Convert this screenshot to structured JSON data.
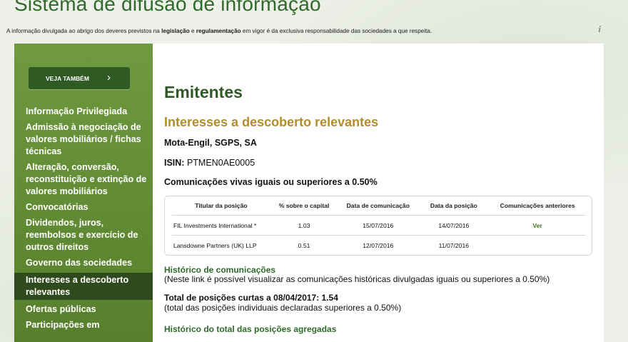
{
  "site": {
    "title": "Sistema de difusão de informação",
    "disclaimer": {
      "part1": "A informação divulgada ao abrigo dos deveres previstos na ",
      "bold1": "legislação",
      "part2": " e ",
      "bold2": "regulamentação",
      "part3": " em vigor é da exclusiva responsabilidade das sociedades a que respeita."
    },
    "info_icon": "i"
  },
  "sidebar": {
    "veja_label": "VEJA TAMBÉM",
    "veja_chevron": "›",
    "items": [
      {
        "label": "Informação Privilegiada"
      },
      {
        "label": "Admissão à negociação de valores mobiliários / fichas técnicas"
      },
      {
        "label": "Alteração, conversão, reconstituição e extinção de valores mobiliários"
      },
      {
        "label": "Convocatórias"
      },
      {
        "label": "Dividendos, juros, reembolsos e exercício de outros direitos"
      },
      {
        "label": "Governo das sociedades"
      },
      {
        "label": "Interesses a descoberto relevantes",
        "active": true
      },
      {
        "label": "Ofertas públicas"
      },
      {
        "label": "Participações em"
      }
    ]
  },
  "main": {
    "heading": "Emitentes",
    "subheading": "Interesses a descoberto relevantes",
    "company": "Mota-Engil, SGPS, SA",
    "isin_label": "ISIN:",
    "isin_value": " PTMEN0AE0005",
    "communications_title": "Comunicações vivas iguais ou superiores a 0.50%",
    "table": {
      "headers": [
        "Titular da posição",
        "% sobre o capital",
        "Data de comunicação",
        "Data da posição",
        "Comunicações anteriores"
      ],
      "rows": [
        [
          "FIL Investments International *",
          "1.03",
          "15/07/2016",
          "14/07/2016",
          "Ver"
        ],
        [
          "Lansdowne Partners (UK) LLP",
          "0.51",
          "12/07/2016",
          "11/07/2016",
          ""
        ]
      ]
    },
    "history_title": "Histórico de comunicações",
    "history_text": "(Neste link é possível visualizar as comunicações históricas divulgadas iguais ou superiores a 0.50%)",
    "total_title": "Total de posições curtas a 08/04/2017: 1.54",
    "total_text": "(total das posições individuais declaradas superiores a 0.50%)",
    "aggregate_title": "Histórico do total das posições agregadas"
  }
}
